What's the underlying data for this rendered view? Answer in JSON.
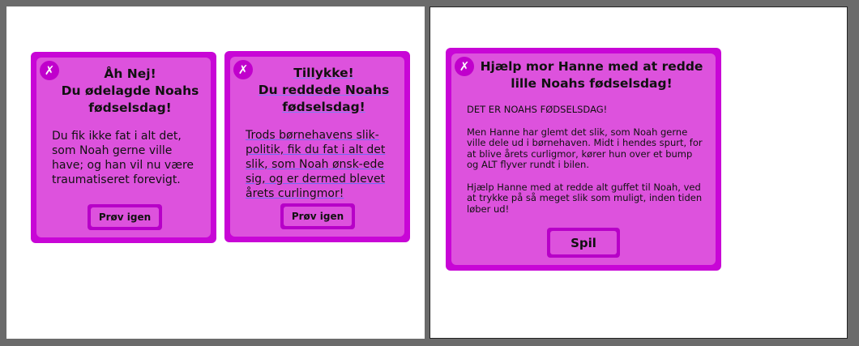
{
  "cards": {
    "fail": {
      "close_icon": "✗",
      "title": "Åh Nej!\nDu ødelagde Noahs\nfødselsdag!",
      "body": "Du fik ikke fat i alt det, som Noah gerne ville have; og han vil nu være traumatiseret forevigt.",
      "button_label": "Prøv igen"
    },
    "success": {
      "close_icon": "✗",
      "title_line1": "Tillykke!",
      "title_line2": "Du reddede Noahs",
      "title_line3": "fødselsdag!",
      "body": "Trods børnehavens slik-politik, fik du fat i alt det slik, som Noah ønsk-ede sig, og er dermed blevet årets curlingmor!",
      "button_label": "Prøv igen"
    },
    "intro": {
      "close_icon": "✗",
      "title": "Hjælp mor Hanne med at redde\nlille Noahs fødselsdag!",
      "paragraph1": "DET ER NOAHS FØDSELSDAG!",
      "paragraph2": "Men Hanne har glemt det slik, som Noah gerne ville dele ud i børnehaven. Midt i hendes spurt, for at blive årets curligmor, kører hun over et bump og ALT flyver rundt i bilen.",
      "paragraph3": "Hjælp Hanne med at redde alt guffet til Noah, ved at trykke på så meget slik som muligt, inden tiden løber ud!",
      "button_label": "Spil"
    }
  },
  "colors": {
    "card_border": "#c806d6",
    "card_fill": "#dd52dd",
    "button_border": "#b700c8",
    "canvas_gray": "#6b6b6b"
  }
}
